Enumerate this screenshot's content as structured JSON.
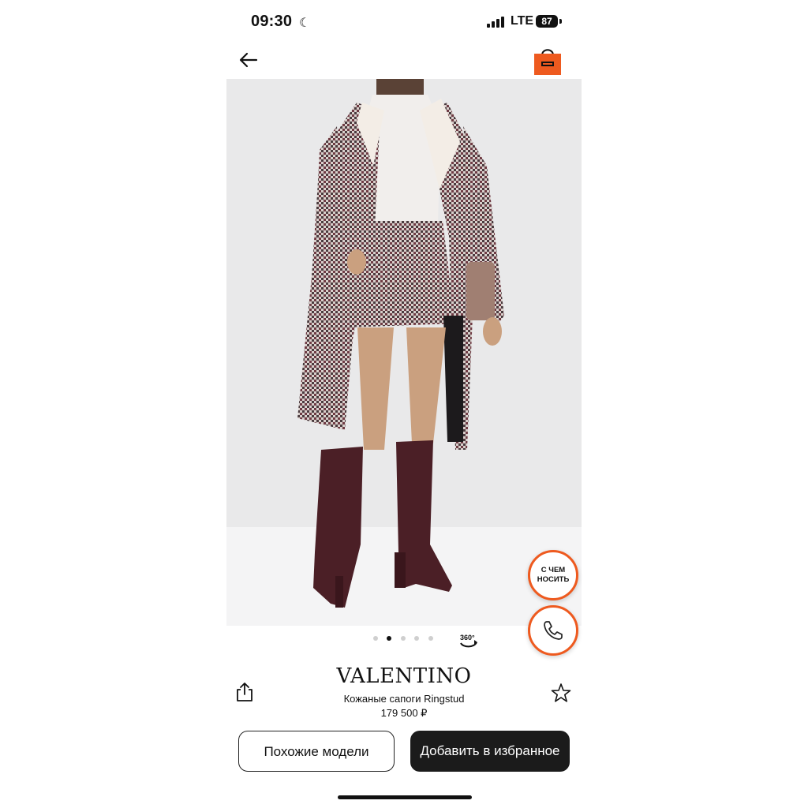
{
  "status_bar": {
    "time": "09:30",
    "network": "LTE",
    "battery": "87"
  },
  "header": {
    "back_icon": "arrow-left-icon",
    "bag_icon": "shopping-bag-icon",
    "accent_color": "#ee5a1f"
  },
  "gallery": {
    "image_description_icon": "product-photo",
    "page_count": 5,
    "active_page": 2,
    "view_360_label": "360°"
  },
  "floating_actions": {
    "outfit_label_line1": "С ЧЕМ",
    "outfit_label_line2": "НОСИТЬ",
    "call_icon": "phone-icon"
  },
  "product": {
    "brand": "VALENTINO",
    "name": "Кожаные сапоги Ringstud",
    "price": "179 500 ₽"
  },
  "actions": {
    "share_icon": "share-icon",
    "favorite_icon": "star-icon",
    "similar_label": "Похожие модели",
    "add_favorite_label": "Добавить в избранное"
  }
}
